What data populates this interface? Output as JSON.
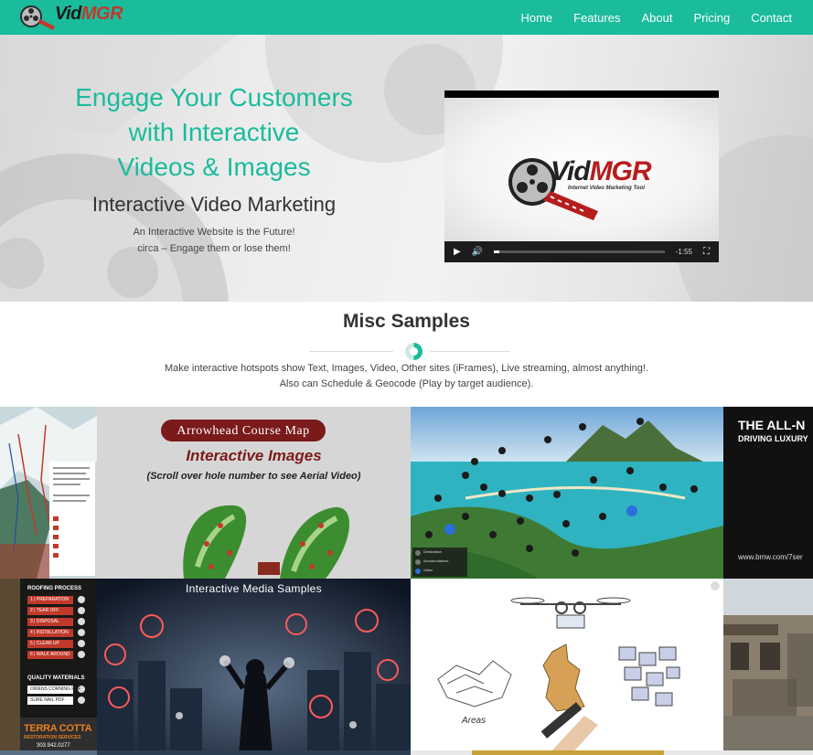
{
  "nav": {
    "logo": {
      "part1": "Vid",
      "part2": "MGR"
    },
    "links": [
      "Home",
      "Features",
      "About",
      "Pricing",
      "Contact"
    ]
  },
  "hero": {
    "headline": [
      "Engage Your Customers",
      "with Interactive",
      "Videos & Images"
    ],
    "subheading": "Interactive Video Marketing",
    "tagline": [
      "An Interactive Website is the Future!",
      "circa – Engage them or lose them!"
    ],
    "video": {
      "logo_part1": "Vid",
      "logo_part2": "MGR",
      "logo_tagline": "Internet Video Marketing Tool",
      "time": "-1:55",
      "progress": 0.03
    }
  },
  "samples": {
    "title": "Misc Samples",
    "description": [
      "Make interactive hotspots show Text, Images, Video, Other sites (iFrames), Live streaming, almost anything!.",
      "Also can Schedule & Geocode (Play by target audience)."
    ]
  },
  "gallery": {
    "golf": {
      "banner": "Arrowhead Course Map",
      "title": "Interactive Images",
      "subtitle": "(Scroll over hole number to see Aerial Video)"
    },
    "island": {
      "legend": [
        "Destination",
        "Accomodations",
        "Video"
      ]
    },
    "bmw": {
      "headline": "THE ALL-N",
      "subline": "DRIVING LUXURY",
      "url": "www.bmw.com/7ser"
    },
    "roofing": {
      "header": "ROOFING PROCESS",
      "steps": [
        "1 | PREPARATION",
        "2 | TEAR OFF",
        "3 | DISPOSAL",
        "4 | INSTALLATION",
        "5 | CLEAN UP",
        "6 | WALK AROUND"
      ],
      "materials_header": "QUALITY MATERIALS",
      "materials": [
        "OWENS CORNING PDF",
        "SURE NAIL PDF"
      ],
      "brand": "TERRA COTTA",
      "brand_sub": "RESTORATION SERVICES",
      "phone": "303.942.0277"
    },
    "media": {
      "title": "Interactive Media Samples"
    },
    "drone": {
      "areas_label": "Areas"
    }
  }
}
